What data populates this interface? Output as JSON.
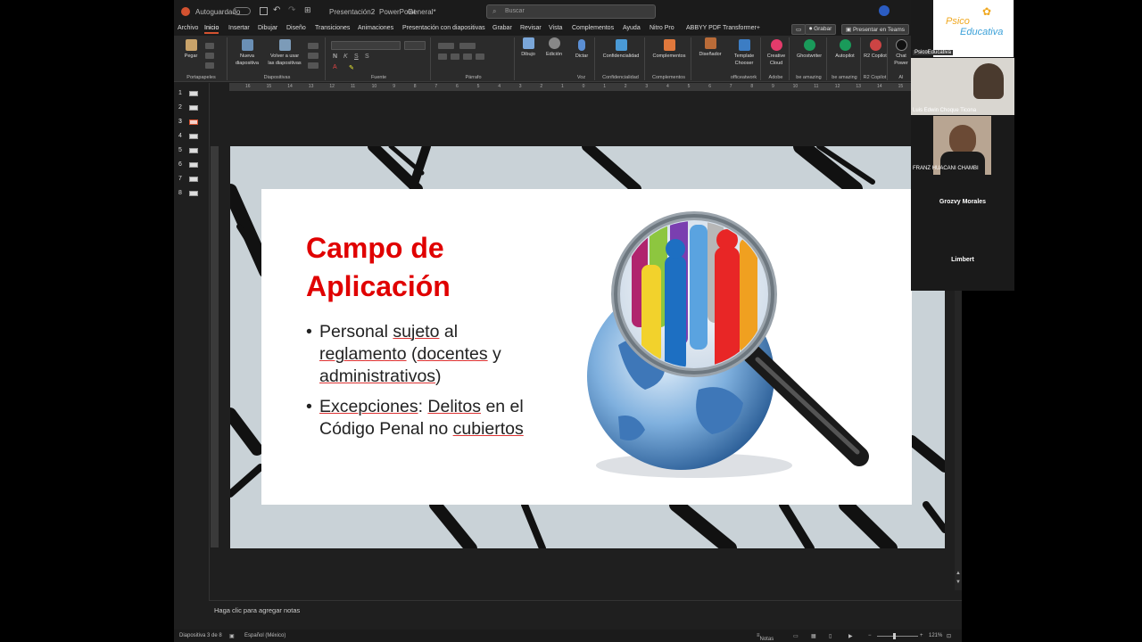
{
  "titlebar": {
    "autosave": "Autoguardado",
    "doc_name": "Presentación2",
    "app_name": "PowerPoint",
    "sensitivity": "General*",
    "search_placeholder": "Buscar"
  },
  "tabs": [
    "Archivo",
    "Inicio",
    "Insertar",
    "Dibujar",
    "Diseño",
    "Transiciones",
    "Animaciones",
    "Presentación con diapositivas",
    "Grabar",
    "Revisar",
    "Vista",
    "Complementos",
    "Ayuda",
    "Nitro Pro",
    "ABBYY PDF Transformer+"
  ],
  "active_tab": "Inicio",
  "top_buttons": {
    "record": "Grabar",
    "teams": "Presentar en Teams"
  },
  "ribbon": {
    "paste": "Pegar",
    "new_slide": "Nueva diapositiva",
    "reuse": "Volver a usar las diapositivas",
    "drawing": "Dibujo",
    "editing": "Edición",
    "dictate": "Dictar",
    "confidentiality": "Confidencialidad",
    "addins": "Complementos",
    "designer": "Diseñador",
    "template_chooser": "Template Chooser",
    "creative_cloud": "Creative Cloud",
    "ghostwriter": "Ghostwriter",
    "autopilot": "Autopilot",
    "r2_copilot": "R2 Copilot",
    "chat_power": "Chat Power",
    "groups": {
      "clipboard": "Portapapeles",
      "slides": "Diapositivas",
      "font": "Fuente",
      "paragraph": "Párrafo",
      "voice": "Voz",
      "confidentiality": "Confidencialidad",
      "addins": "Complementos",
      "officeatwork": "officeatwork",
      "adobe": "Adobe",
      "be_amazing_1": "be amazing",
      "be_amazing_2": "be amazing",
      "r2_copilot": "R2 Copilot",
      "ai": "AI"
    }
  },
  "ruler_marks": [
    "16",
    "15",
    "14",
    "13",
    "12",
    "11",
    "10",
    "9",
    "8",
    "7",
    "6",
    "5",
    "4",
    "3",
    "2",
    "1",
    "0",
    "1",
    "2",
    "3",
    "4",
    "5",
    "6",
    "7",
    "8",
    "9",
    "10",
    "11",
    "12",
    "13",
    "14",
    "15",
    "16"
  ],
  "thumbnails": [
    "1",
    "2",
    "3",
    "4",
    "5",
    "6",
    "7",
    "8"
  ],
  "selected_slide": 3,
  "slide": {
    "title_line1": "Campo de",
    "title_line2": "Aplicación",
    "bullet1_parts": [
      "Personal ",
      "sujeto",
      " al ",
      "reglamento",
      " (",
      "docentes",
      " y ",
      "administrativos",
      ")"
    ],
    "bullet2_parts": [
      "Excepciones",
      ": ",
      "Delitos",
      " en el Código Penal no ",
      "cubiertos"
    ],
    "image_description_icon": "magnifier-globe-people-icon"
  },
  "notes_placeholder": "Haga clic para agregar notas",
  "status": {
    "slide_pos": "Diapositiva 3 de 8",
    "language": "Español (México)",
    "notes": "Notas",
    "zoom": "121%"
  },
  "video": {
    "brand_line1": "Psico",
    "brand_line2": "Educativa",
    "brand_tile_name": "PsicoEducativa",
    "p1": "Luis Edwin Choque Ticona",
    "p2": "FRANZ HUACANI CHAMBI",
    "p3": "Grozvy Morales",
    "p4": "Limbert"
  },
  "colors": {
    "accent": "#d35230",
    "title_red": "#e00000"
  }
}
